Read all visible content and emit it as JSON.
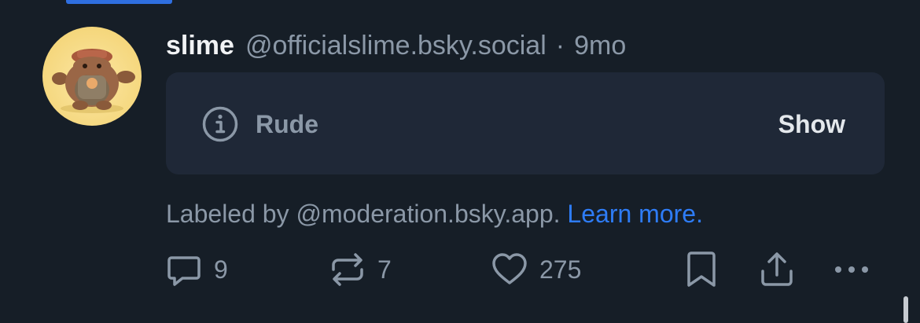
{
  "post": {
    "author_name": "slime",
    "author_handle": "@officialslime.bsky.social",
    "separator": "·",
    "timestamp": "9mo",
    "avatar_alt": "slime avatar"
  },
  "moderation": {
    "label": "Rude",
    "show_label": "Show",
    "labeled_by_text": "Labeled by @moderation.bsky.app.",
    "learn_more_label": "Learn more."
  },
  "actions": {
    "reply_count": "9",
    "repost_count": "7",
    "like_count": "275"
  },
  "icons": {
    "reply": "reply-icon",
    "repost": "repost-icon",
    "like": "heart-icon",
    "bookmark": "bookmark-icon",
    "share": "share-icon",
    "more": "more-icon",
    "info": "info-icon"
  },
  "colors": {
    "background": "#161e27",
    "card": "#1f2837",
    "accent": "#2e7cf6",
    "muted": "#8b98a7",
    "text": "#f1f3f5"
  }
}
